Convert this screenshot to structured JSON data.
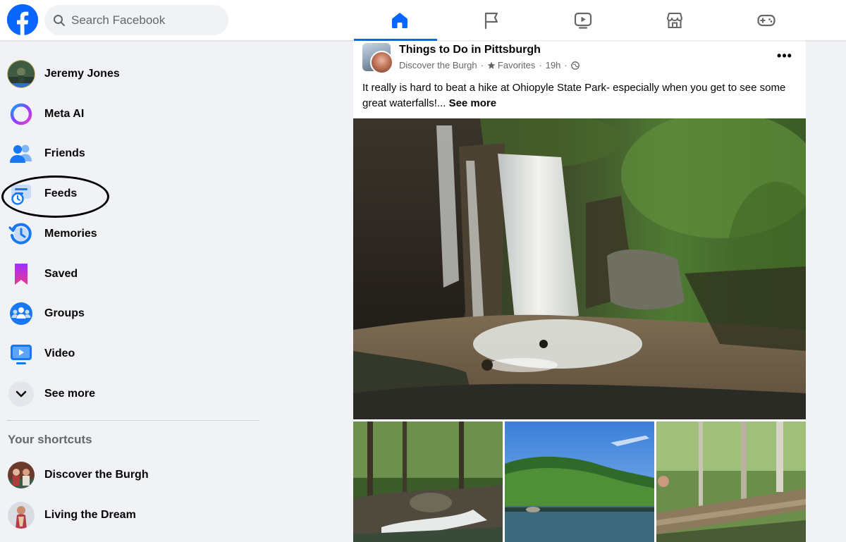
{
  "search": {
    "placeholder": "Search Facebook"
  },
  "nav_tabs": [
    {
      "name": "home",
      "icon": "home-icon",
      "active": true
    },
    {
      "name": "pages",
      "icon": "flag-icon",
      "active": false
    },
    {
      "name": "video",
      "icon": "video-icon",
      "active": false
    },
    {
      "name": "marketplace",
      "icon": "marketplace-icon",
      "active": false
    },
    {
      "name": "gaming",
      "icon": "gaming-icon",
      "active": false
    }
  ],
  "sidebar": {
    "items": [
      {
        "label": "Jeremy Jones",
        "icon": "profile-avatar"
      },
      {
        "label": "Meta AI",
        "icon": "meta-ai-icon"
      },
      {
        "label": "Friends",
        "icon": "friends-icon"
      },
      {
        "label": "Feeds",
        "icon": "feeds-icon"
      },
      {
        "label": "Memories",
        "icon": "memories-icon"
      },
      {
        "label": "Saved",
        "icon": "saved-icon"
      },
      {
        "label": "Groups",
        "icon": "groups-icon"
      },
      {
        "label": "Video",
        "icon": "video-icon"
      },
      {
        "label": "See more",
        "icon": "chevron-down-icon"
      }
    ],
    "shortcuts_title": "Your shortcuts",
    "shortcuts": [
      {
        "label": "Discover the Burgh",
        "icon": "shortcut-avatar"
      },
      {
        "label": "Living the Dream",
        "icon": "shortcut-avatar"
      }
    ]
  },
  "post": {
    "group_name": "Things to Do in Pittsburgh",
    "author": "Discover the Burgh",
    "badge": "Favorites",
    "time": "19h",
    "text": "It really is hard to beat a hike at Ohiopyle State Park- especially when you get to see some great waterfalls!...",
    "see_more": "See more"
  },
  "colors": {
    "brand": "#0866ff",
    "background": "#f0f2f5"
  }
}
